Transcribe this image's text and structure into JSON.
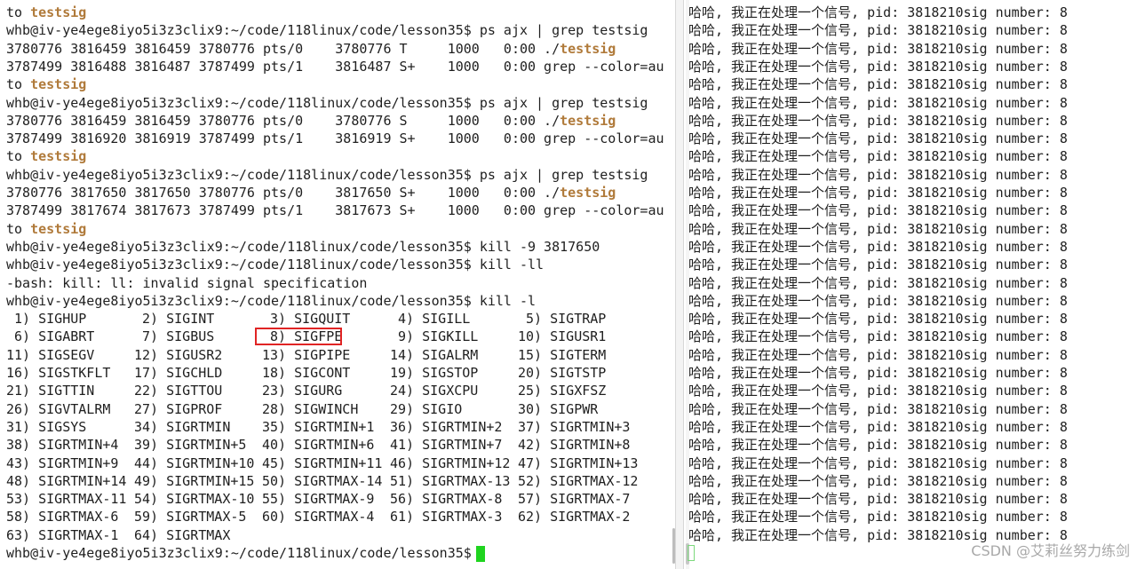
{
  "left_terminal": {
    "lines": [
      {
        "pre": "to ",
        "hl": "testsig",
        "post": ""
      },
      {
        "pre": "whb@iv-ye4ege8iyo5i3z3clix9:~/code/118linux/code/lesson35$ ps ajx | grep testsig",
        "hl": "",
        "post": ""
      },
      {
        "pre": "3780776 3816459 3816459 3780776 pts/0    3780776 T     1000   0:00 ./",
        "hl": "testsig",
        "post": ""
      },
      {
        "pre": "3787499 3816488 3816487 3787499 pts/1    3816487 S+    1000   0:00 grep --color=au",
        "hl": "",
        "post": ""
      },
      {
        "pre": "to ",
        "hl": "testsig",
        "post": ""
      },
      {
        "pre": "whb@iv-ye4ege8iyo5i3z3clix9:~/code/118linux/code/lesson35$ ps ajx | grep testsig",
        "hl": "",
        "post": ""
      },
      {
        "pre": "3780776 3816459 3816459 3780776 pts/0    3780776 S     1000   0:00 ./",
        "hl": "testsig",
        "post": ""
      },
      {
        "pre": "3787499 3816920 3816919 3787499 pts/1    3816919 S+    1000   0:00 grep --color=au",
        "hl": "",
        "post": ""
      },
      {
        "pre": "to ",
        "hl": "testsig",
        "post": ""
      },
      {
        "pre": "whb@iv-ye4ege8iyo5i3z3clix9:~/code/118linux/code/lesson35$ ps ajx | grep testsig",
        "hl": "",
        "post": ""
      },
      {
        "pre": "3780776 3817650 3817650 3780776 pts/0    3817650 S+    1000   0:00 ./",
        "hl": "testsig",
        "post": ""
      },
      {
        "pre": "3787499 3817674 3817673 3787499 pts/1    3817673 S+    1000   0:00 grep --color=au",
        "hl": "",
        "post": ""
      },
      {
        "pre": "to ",
        "hl": "testsig",
        "post": ""
      },
      {
        "pre": "whb@iv-ye4ege8iyo5i3z3clix9:~/code/118linux/code/lesson35$ kill -9 3817650",
        "hl": "",
        "post": ""
      },
      {
        "pre": "whb@iv-ye4ege8iyo5i3z3clix9:~/code/118linux/code/lesson35$ kill -ll",
        "hl": "",
        "post": ""
      },
      {
        "pre": "-bash: kill: ll: invalid signal specification",
        "hl": "",
        "post": ""
      },
      {
        "pre": "whb@iv-ye4ege8iyo5i3z3clix9:~/code/118linux/code/lesson35$ kill -l",
        "hl": "",
        "post": ""
      }
    ],
    "signals": [
      [
        " 1) SIGHUP",
        " 2) SIGINT",
        " 3) SIGQUIT",
        " 4) SIGILL",
        " 5) SIGTRAP"
      ],
      [
        " 6) SIGABRT",
        " 7) SIGBUS",
        " 8) SIGFPE",
        " 9) SIGKILL",
        "10) SIGUSR1"
      ],
      [
        "11) SIGSEGV",
        "12) SIGUSR2",
        "13) SIGPIPE",
        "14) SIGALRM",
        "15) SIGTERM"
      ],
      [
        "16) SIGSTKFLT",
        "17) SIGCHLD",
        "18) SIGCONT",
        "19) SIGSTOP",
        "20) SIGTSTP"
      ],
      [
        "21) SIGTTIN",
        "22) SIGTTOU",
        "23) SIGURG",
        "24) SIGXCPU",
        "25) SIGXFSZ"
      ],
      [
        "26) SIGVTALRM",
        "27) SIGPROF",
        "28) SIGWINCH",
        "29) SIGIO",
        "30) SIGPWR"
      ],
      [
        "31) SIGSYS",
        "34) SIGRTMIN",
        "35) SIGRTMIN+1",
        "36) SIGRTMIN+2",
        "37) SIGRTMIN+3"
      ],
      [
        "38) SIGRTMIN+4",
        "39) SIGRTMIN+5",
        "40) SIGRTMIN+6",
        "41) SIGRTMIN+7",
        "42) SIGRTMIN+8"
      ],
      [
        "43) SIGRTMIN+9",
        "44) SIGRTMIN+10",
        "45) SIGRTMIN+11",
        "46) SIGRTMIN+12",
        "47) SIGRTMIN+13"
      ],
      [
        "48) SIGRTMIN+14",
        "49) SIGRTMIN+15",
        "50) SIGRTMAX-14",
        "51) SIGRTMAX-13",
        "52) SIGRTMAX-12"
      ],
      [
        "53) SIGRTMAX-11",
        "54) SIGRTMAX-10",
        "55) SIGRTMAX-9",
        "56) SIGRTMAX-8",
        "57) SIGRTMAX-7"
      ],
      [
        "58) SIGRTMAX-6",
        "59) SIGRTMAX-5",
        "60) SIGRTMAX-4",
        "61) SIGRTMAX-3",
        "62) SIGRTMAX-2"
      ],
      [
        "63) SIGRTMAX-1",
        "64) SIGRTMAX"
      ]
    ],
    "final_prompt": "whb@iv-ye4ege8iyo5i3z3clix9:~/code/118linux/code/lesson35$ ",
    "highlight_color": "#b07a3a",
    "cursor_color": "#1fd41f",
    "boxed_signal": " 8) SIGFPE"
  },
  "right_terminal": {
    "line_text": "哈哈, 我正在处理一个信号, pid: 3818210sig number: 8",
    "line_count": 30
  },
  "watermark": "CSDN @艾莉丝努力练剑"
}
